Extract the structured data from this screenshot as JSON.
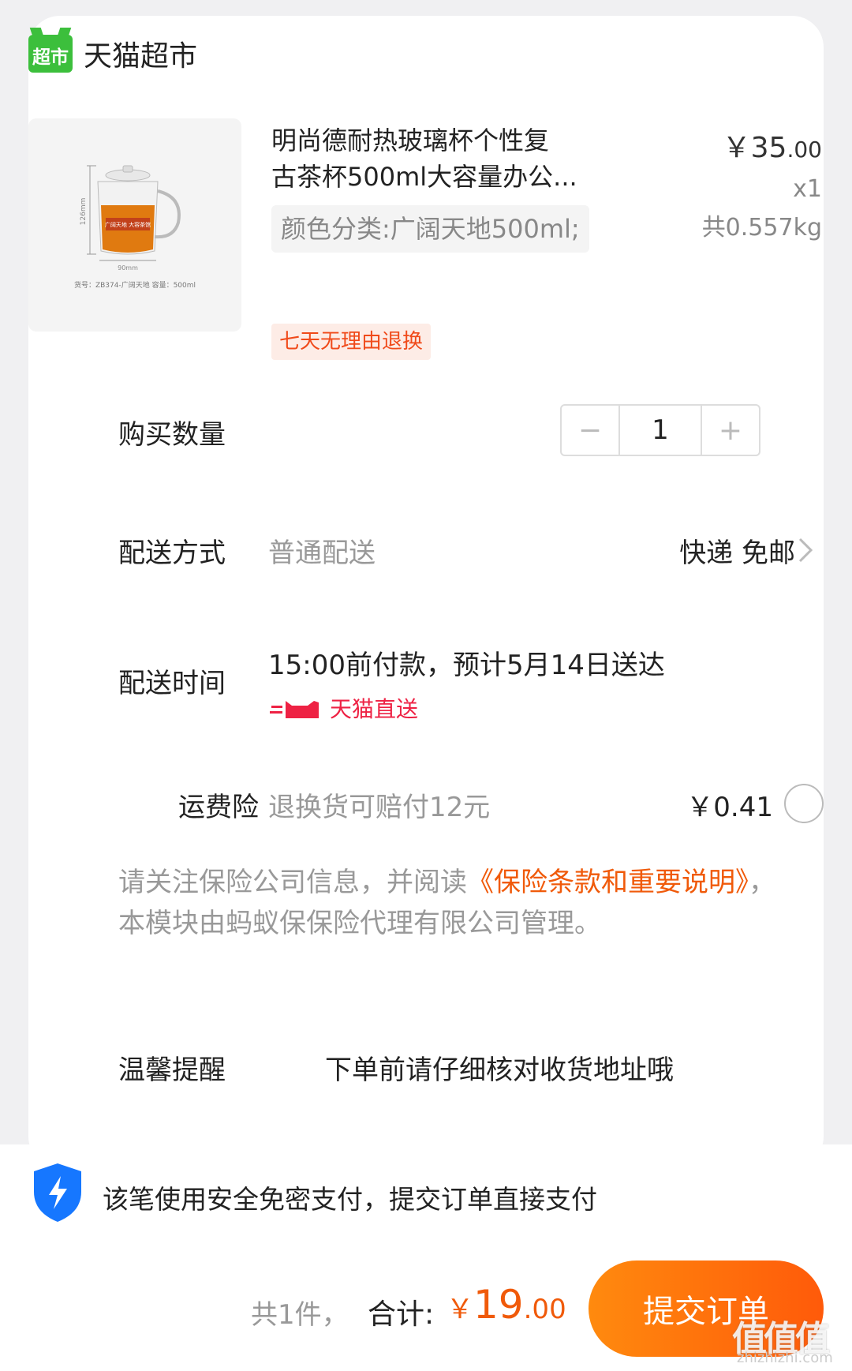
{
  "store": {
    "name": "天猫超市",
    "logo_text": "超市"
  },
  "product": {
    "title_line1": "明尚德耐热玻璃杯个性复",
    "title_line2": "古茶杯500ml大容量办公...",
    "sku": "颜色分类:广阔天地500ml;",
    "price_symbol": "￥",
    "price_main": "35",
    "price_decimal": ".00",
    "qty_label": "x1",
    "weight": "共0.557kg",
    "return_badge": "七天无理由退换",
    "image": {
      "height_label": "126mm",
      "width_label": "90mm",
      "cup_label": "广阔天地 大容茶馆",
      "caption": "货号：ZB374-广阔天地   容量：500ml"
    }
  },
  "quantity": {
    "label": "购买数量",
    "value": "1",
    "minus": "−",
    "plus": "+"
  },
  "delivery": {
    "label": "配送方式",
    "value": "普通配送",
    "right": "快递 免邮"
  },
  "delivery_time": {
    "label": "配送时间",
    "value": "15:00前付款，预计5月14日送达",
    "service": "天猫直送"
  },
  "insurance": {
    "label": "运费险",
    "desc": "退换货可赔付12元",
    "price": "￥0.41"
  },
  "notice": {
    "part1": "请关注保险公司信息，并阅读",
    "link": "《保险条款和重要说明》",
    "part2": "，本模块由蚂蚁保保险代理有限公司管理。"
  },
  "reminder": {
    "label": "温馨提醒",
    "text": "下单前请仔细核对收货地址哦"
  },
  "payment": {
    "text": "该笔使用安全免密支付，提交订单直接支付"
  },
  "footer": {
    "count": "共1件，",
    "total_label": "合计:",
    "symbol": "￥",
    "amount_main": "19",
    "amount_decimal": ".00",
    "submit": "提交订单"
  },
  "watermark": {
    "text": "值值值",
    "url": "zhizhizhi.com"
  },
  "colors": {
    "accent": "#f05a0a",
    "brand_green": "#3cbf3c",
    "tmall_red": "#ee2244",
    "shield_blue": "#1677ff"
  }
}
